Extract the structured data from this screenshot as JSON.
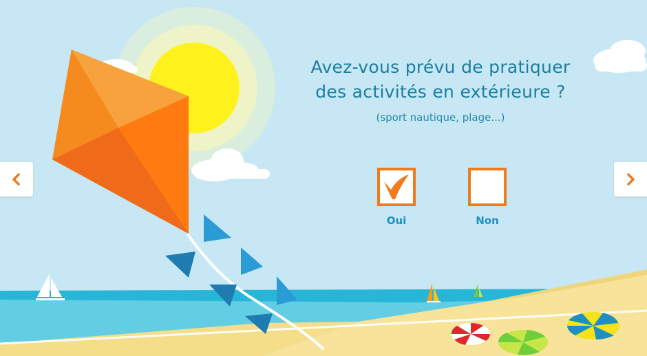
{
  "question": {
    "line1": "Avez-vous prévu de pratiquer",
    "line2": "des activités en extérieure ?",
    "subtitle": "(sport nautique, plage...)"
  },
  "choices": [
    {
      "label": "Oui",
      "checked": true
    },
    {
      "label": "Non",
      "checked": false
    }
  ],
  "navigation": {
    "prev_icon": "chevron-left-icon",
    "next_icon": "chevron-right-icon"
  },
  "colors": {
    "sky": "#c6e7f3",
    "accent_orange": "#f07a1c",
    "question_text": "#1c7ea2",
    "label_blue": "#1f8fc0",
    "sea": "#27b6d8",
    "sand": "#f7e49a"
  }
}
